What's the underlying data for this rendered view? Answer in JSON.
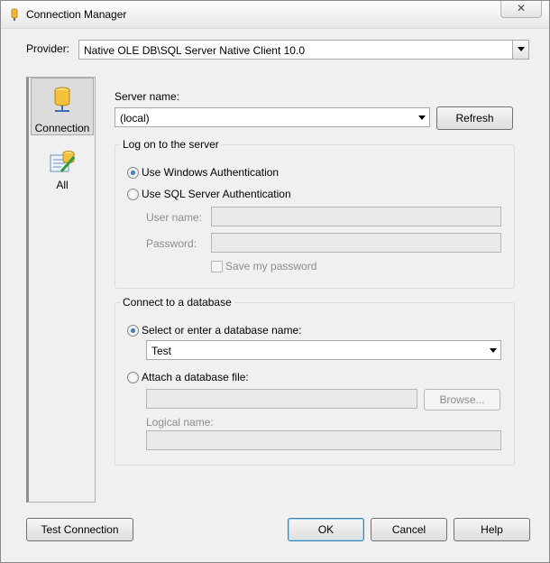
{
  "window": {
    "title": "Connection Manager",
    "close_glyph": "✕"
  },
  "provider": {
    "label": "Provider:",
    "value": "Native OLE DB\\SQL Server Native Client 10.0"
  },
  "sidebar": {
    "items": [
      {
        "label": "Connection",
        "icon": "database-icon"
      },
      {
        "label": "All",
        "icon": "properties-icon"
      }
    ]
  },
  "server": {
    "label": "Server name:",
    "value": "(local)",
    "refresh": "Refresh"
  },
  "logon": {
    "title": "Log on to the server",
    "windows_auth": "Use Windows Authentication",
    "sql_auth": "Use SQL Server Authentication",
    "user_label": "User name:",
    "password_label": "Password:",
    "save_password": "Save my password",
    "selected": "windows"
  },
  "database": {
    "title": "Connect to a database",
    "select_label": "Select or enter a database name:",
    "value": "Test",
    "attach_label": "Attach a database file:",
    "browse": "Browse...",
    "logical_label": "Logical name:",
    "selected": "select"
  },
  "buttons": {
    "test": "Test Connection",
    "ok": "OK",
    "cancel": "Cancel",
    "help": "Help"
  },
  "colors": {
    "accent": "#3c7fb1",
    "radio_fill": "#1c4f8f",
    "disabled_text": "#8d8d8d"
  }
}
